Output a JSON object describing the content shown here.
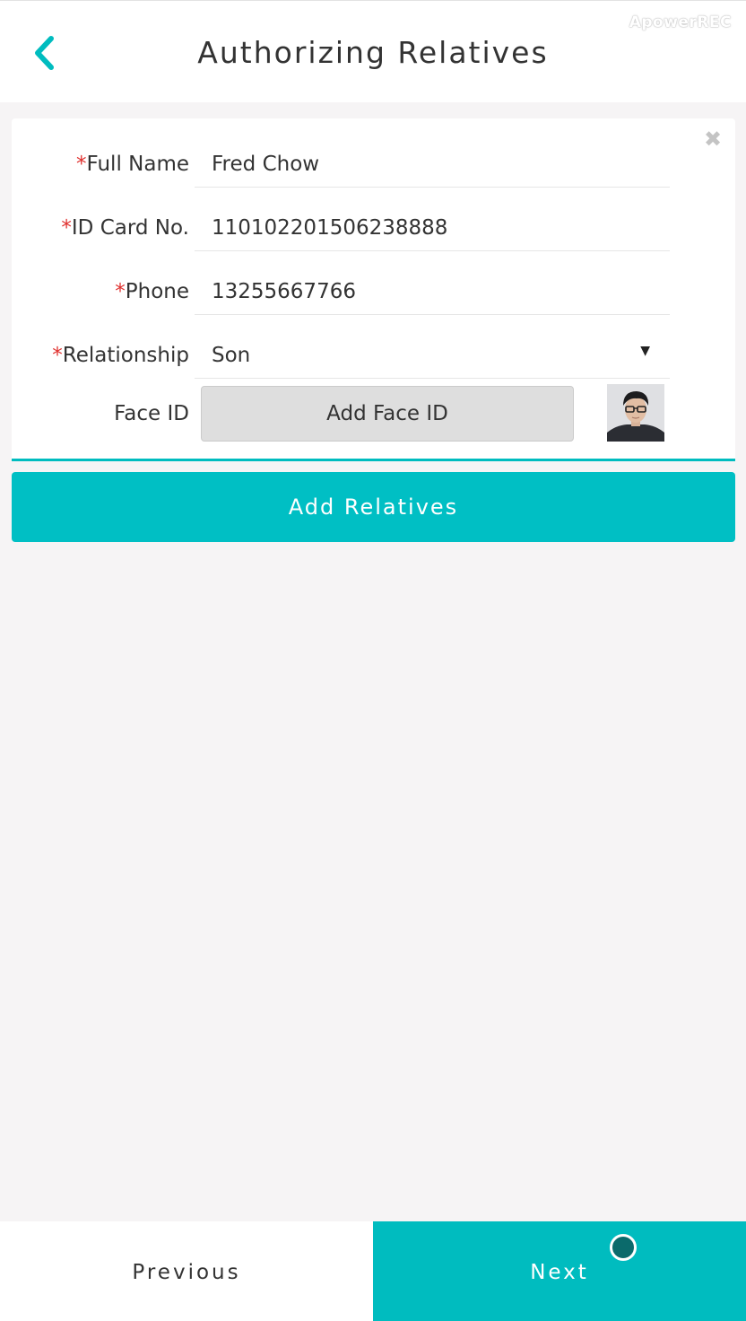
{
  "header": {
    "title": "Authorizing Relatives",
    "watermark": "ApowerREC"
  },
  "form": {
    "full_name": {
      "required_mark": "*",
      "label": "Full Name",
      "value": "Fred Chow"
    },
    "id_card": {
      "required_mark": "*",
      "label": "ID Card No.",
      "value": "110102201506238888"
    },
    "phone": {
      "required_mark": "*",
      "label": "Phone",
      "value": "13255667766"
    },
    "relationship": {
      "required_mark": "*",
      "label": "Relationship",
      "value": "Son",
      "caret": "▼"
    },
    "face_id": {
      "label": "Face ID",
      "button_label": "Add Face ID"
    },
    "close_glyph": "✖"
  },
  "actions": {
    "add_relatives_label": "Add Relatives"
  },
  "footer": {
    "previous_label": "Previous",
    "next_label": "Next"
  },
  "colors": {
    "accent": "#00bcbf",
    "required": "#e0312f",
    "background": "#f6f4f5"
  },
  "icons": {
    "back": "chevron-left-icon",
    "close": "close-icon",
    "dropdown": "caret-down-icon"
  }
}
